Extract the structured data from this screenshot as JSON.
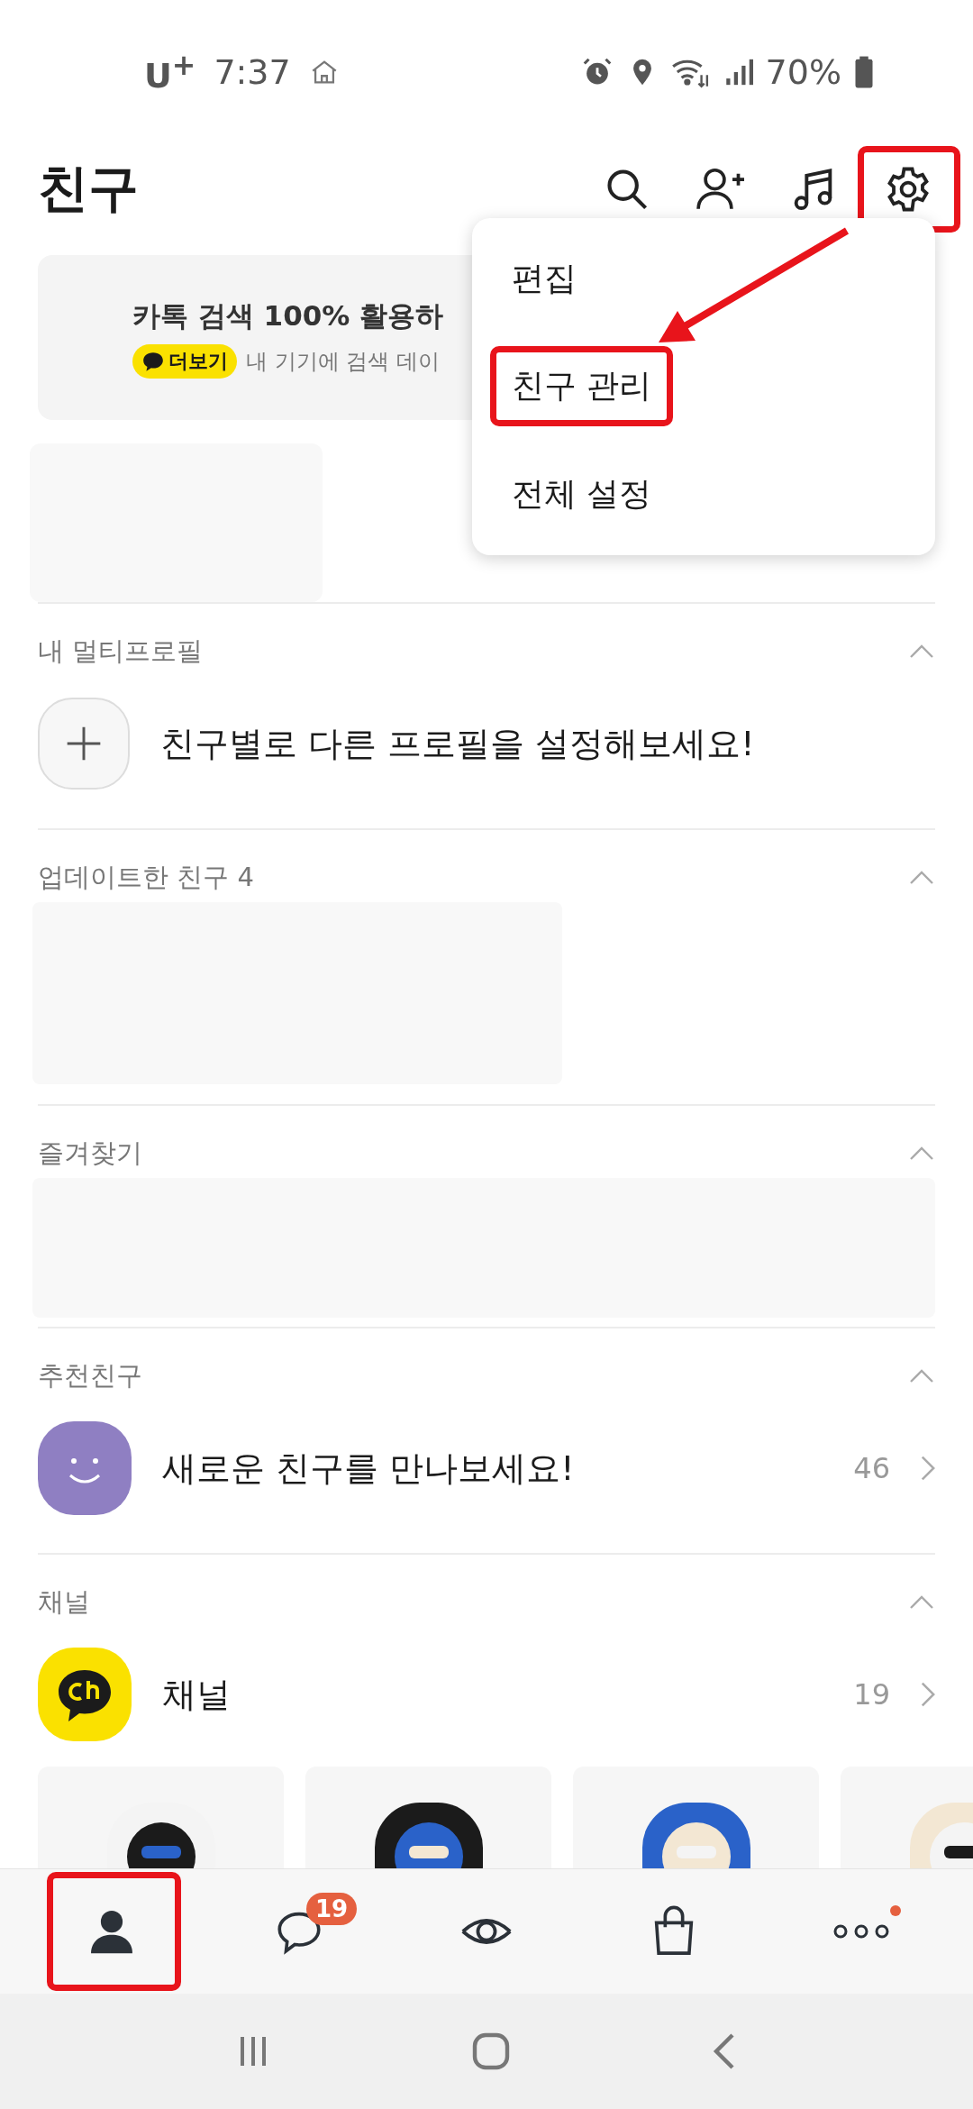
{
  "status_bar": {
    "carrier": "U$^{+}$",
    "time": "7:37",
    "battery": "70%"
  },
  "header": {
    "title": "친구",
    "actions": [
      {
        "kind": "search"
      },
      {
        "kind": "add-friend"
      },
      {
        "kind": "music"
      },
      {
        "kind": "settings",
        "highlighted": true
      }
    ]
  },
  "banner": {
    "title": "카톡 검색 100% 활용하",
    "badge": "더보기",
    "text": "내 기기에 검색 데이"
  },
  "menu": {
    "items": [
      {
        "label": "편집",
        "highlighted": false
      },
      {
        "label": "친구 관리",
        "highlighted": true
      },
      {
        "label": "전체 설정",
        "highlighted": false
      }
    ]
  },
  "annotation": {
    "arrow": true
  },
  "sections": [
    {
      "kind": "add-row",
      "title": "내 멀티프로필",
      "expanded": true,
      "text": "친구별로 다른 프로필을 설정해보세요!"
    },
    {
      "kind": "blank-half",
      "title": "업데이트한 친구 4",
      "expanded": true
    },
    {
      "kind": "blank-wide",
      "title": "즐겨찾기",
      "expanded": true
    },
    {
      "kind": "recommend-row",
      "title": "추천친구",
      "expanded": true,
      "text": "새로운 친구를 만나보세요!",
      "count": "46"
    },
    {
      "kind": "channel-row",
      "title": "채널",
      "expanded": true,
      "text": "채널",
      "count": "19"
    }
  ],
  "nav": {
    "tabs": [
      {
        "kind": "friends",
        "selected": true,
        "highlighted": true
      },
      {
        "kind": "chats",
        "selected": false,
        "highlighted": false,
        "badge": "19"
      },
      {
        "kind": "view",
        "selected": false,
        "highlighted": false
      },
      {
        "kind": "shopping",
        "selected": false,
        "highlighted": false
      },
      {
        "kind": "more",
        "selected": false,
        "highlighted": false,
        "dot": true
      }
    ]
  }
}
